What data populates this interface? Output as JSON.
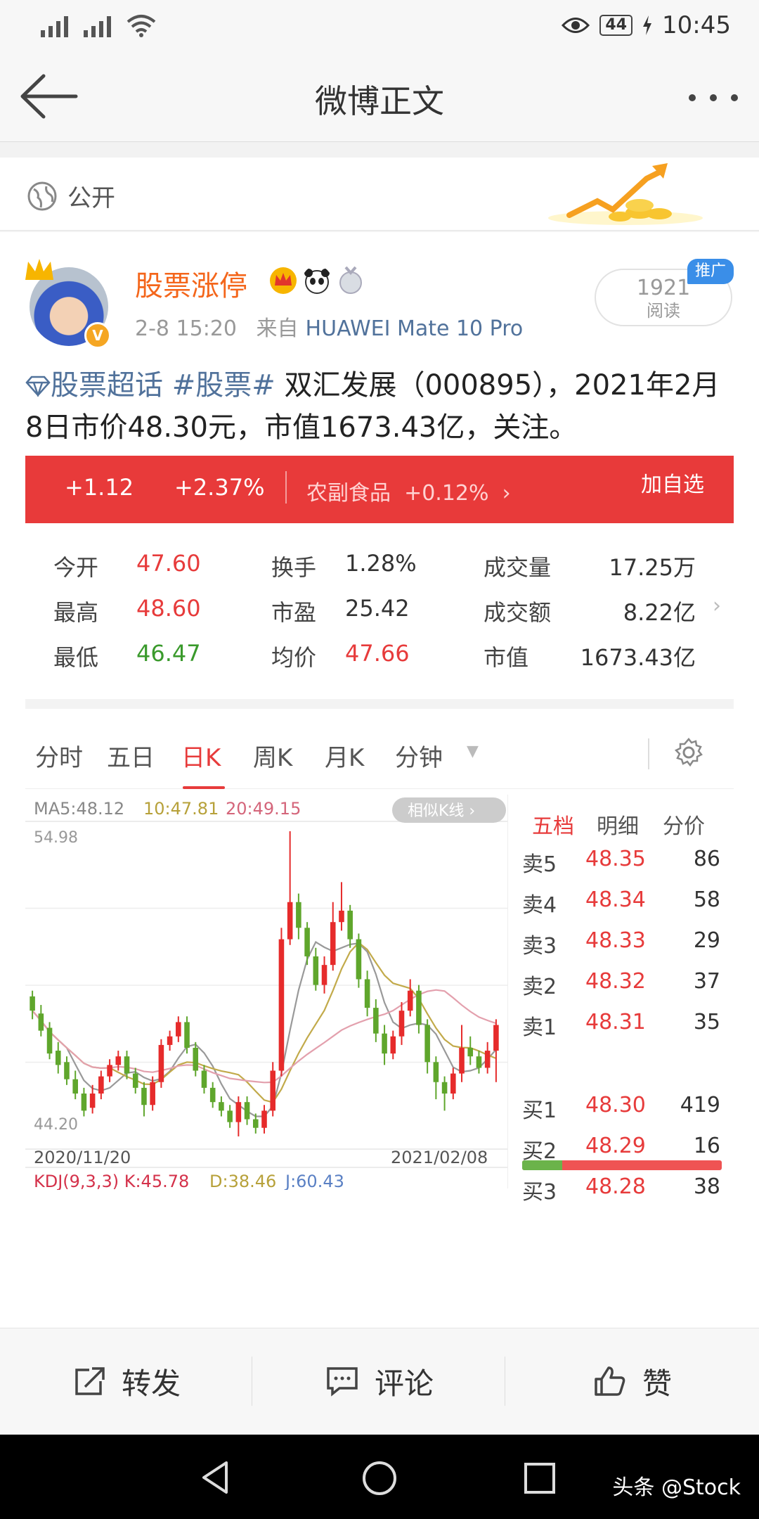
{
  "status_bar": {
    "time": "10:45",
    "battery": "44",
    "icons": [
      "signal-icon",
      "signal-icon",
      "wifi-icon",
      "eye-icon",
      "battery-icon",
      "charging-icon"
    ]
  },
  "nav": {
    "title": "微博正文",
    "back_icon": "back-arrow-icon",
    "more_icon": "more-dots-icon"
  },
  "visibility": {
    "icon": "globe-icon",
    "label": "公开"
  },
  "post": {
    "author": "股票涨停",
    "badges": [
      "crown-badge-icon",
      "panda-badge-icon",
      "medal-badge-icon"
    ],
    "time": "2-8 15:20",
    "source_prefix": "来自",
    "source": "HUAWEI Mate 10 Pro",
    "reads": "1921",
    "reads_label": "阅读",
    "ad_tag": "推广",
    "text": {
      "supertopic": "股票超话",
      "hashtag": "#股票#",
      "body": " 双汇发展（000895），2021年2月8日市价48.30元，市值1673.43亿，关注。"
    }
  },
  "quote_bar": {
    "change": "+1.12",
    "change_pct": "+2.37%",
    "sector": "农副食品",
    "sector_change": "+0.12%",
    "add_watchlist": "加自选"
  },
  "stats": [
    {
      "label": "今开",
      "value": "47.60",
      "color": "red"
    },
    {
      "label": "换手",
      "value": "1.28%",
      "color": "dark"
    },
    {
      "label": "成交量",
      "value": "17.25万",
      "color": "dark"
    },
    {
      "label": "最高",
      "value": "48.60",
      "color": "red"
    },
    {
      "label": "市盈",
      "value": "25.42",
      "color": "dark"
    },
    {
      "label": "成交额",
      "value": "8.22亿",
      "color": "dark"
    },
    {
      "label": "最低",
      "value": "46.47",
      "color": "green"
    },
    {
      "label": "均价",
      "value": "47.66",
      "color": "red"
    },
    {
      "label": "市值",
      "value": "1673.43亿",
      "color": "dark"
    }
  ],
  "chart_tabs": {
    "items": [
      "分时",
      "五日",
      "日K",
      "周K",
      "月K",
      "分钟"
    ],
    "active": "日K",
    "settings_icon": "gear-icon"
  },
  "kline": {
    "ma_labels": [
      "MA5:48.12",
      "10:47.81",
      "20:49.15"
    ],
    "similar_btn": "相似K线",
    "y_max_label": "54.98",
    "y_min_label": "44.20",
    "date_start": "2020/11/20",
    "date_end": "2021/02/08",
    "kdj_labels": [
      "KDJ(9,3,3) K:45.78",
      "D:38.46",
      "J:60.43"
    ]
  },
  "chart_data": {
    "type": "candlestick",
    "title": "",
    "ylim": [
      44.2,
      54.98
    ],
    "x_range": [
      "2020/11/20",
      "2021/02/08"
    ],
    "ma": {
      "MA5": 48.12,
      "MA10": 47.81,
      "MA20": 49.15
    },
    "candles": [
      [
        49.2,
        48.7,
        49.4,
        48.4
      ],
      [
        48.6,
        48.0,
        48.9,
        47.8
      ],
      [
        48.1,
        47.2,
        48.3,
        47.0
      ],
      [
        47.3,
        46.8,
        47.6,
        46.5
      ],
      [
        46.9,
        46.3,
        47.1,
        46.1
      ],
      [
        46.3,
        45.8,
        46.6,
        45.6
      ],
      [
        45.8,
        45.2,
        46.0,
        45.0
      ],
      [
        45.3,
        45.8,
        46.1,
        45.1
      ],
      [
        45.8,
        46.4,
        46.6,
        45.6
      ],
      [
        46.4,
        46.8,
        47.0,
        46.2
      ],
      [
        46.8,
        47.1,
        47.3,
        46.6
      ],
      [
        47.1,
        46.5,
        47.3,
        46.3
      ],
      [
        46.5,
        46.0,
        46.7,
        45.8
      ],
      [
        46.0,
        45.4,
        46.2,
        45.0
      ],
      [
        45.4,
        46.2,
        46.4,
        45.2
      ],
      [
        46.2,
        47.5,
        47.7,
        46.0
      ],
      [
        47.5,
        47.8,
        48.0,
        47.3
      ],
      [
        47.8,
        48.3,
        48.5,
        47.6
      ],
      [
        48.3,
        47.4,
        48.5,
        47.2
      ],
      [
        47.4,
        46.6,
        47.6,
        46.4
      ],
      [
        46.6,
        46.0,
        46.8,
        45.8
      ],
      [
        46.0,
        45.5,
        46.2,
        45.3
      ],
      [
        45.5,
        45.2,
        45.7,
        45.0
      ],
      [
        45.2,
        44.8,
        45.4,
        44.6
      ],
      [
        44.8,
        45.5,
        45.7,
        44.3
      ],
      [
        45.5,
        44.9,
        45.7,
        44.7
      ],
      [
        44.9,
        44.6,
        45.1,
        44.4
      ],
      [
        44.6,
        45.2,
        45.4,
        44.4
      ],
      [
        45.2,
        46.6,
        46.9,
        45.0
      ],
      [
        46.6,
        51.2,
        51.6,
        46.4
      ],
      [
        51.2,
        52.5,
        54.98,
        51.0
      ],
      [
        52.5,
        51.6,
        52.8,
        51.2
      ],
      [
        51.6,
        50.6,
        51.8,
        50.3
      ],
      [
        50.6,
        49.6,
        50.9,
        49.4
      ],
      [
        49.6,
        50.3,
        50.6,
        49.3
      ],
      [
        50.3,
        51.8,
        52.5,
        50.1
      ],
      [
        51.8,
        52.2,
        53.2,
        51.5
      ],
      [
        52.2,
        51.2,
        52.4,
        50.9
      ],
      [
        51.2,
        49.8,
        51.4,
        49.5
      ],
      [
        49.8,
        48.8,
        50.1,
        48.5
      ],
      [
        48.8,
        47.9,
        49.1,
        47.6
      ],
      [
        47.9,
        47.2,
        48.2,
        46.8
      ],
      [
        47.2,
        47.8,
        48.0,
        47.0
      ],
      [
        47.8,
        48.7,
        49.0,
        47.5
      ],
      [
        48.7,
        49.4,
        49.8,
        48.5
      ],
      [
        49.4,
        48.2,
        49.6,
        47.9
      ],
      [
        48.2,
        46.9,
        48.4,
        46.5
      ],
      [
        46.9,
        46.2,
        47.1,
        45.6
      ],
      [
        46.2,
        45.8,
        46.4,
        45.2
      ],
      [
        45.8,
        46.5,
        46.7,
        45.6
      ],
      [
        46.5,
        47.4,
        48.2,
        46.2
      ],
      [
        47.4,
        47.1,
        47.8,
        46.8
      ],
      [
        47.1,
        46.7,
        47.3,
        46.5
      ],
      [
        46.7,
        47.3,
        47.6,
        46.5
      ],
      [
        47.3,
        48.2,
        48.4,
        46.2
      ]
    ]
  },
  "order_book": {
    "tabs": [
      "五档",
      "明细",
      "分价"
    ],
    "active_tab": "五档",
    "asks": [
      {
        "name": "卖5",
        "price": "48.35",
        "vol": "86"
      },
      {
        "name": "卖4",
        "price": "48.34",
        "vol": "58"
      },
      {
        "name": "卖3",
        "price": "48.33",
        "vol": "29"
      },
      {
        "name": "卖2",
        "price": "48.32",
        "vol": "37"
      },
      {
        "name": "卖1",
        "price": "48.31",
        "vol": "35"
      }
    ],
    "buy_ratio": 0.2,
    "bids": [
      {
        "name": "买1",
        "price": "48.30",
        "vol": "419"
      },
      {
        "name": "买2",
        "price": "48.29",
        "vol": "16"
      },
      {
        "name": "买3",
        "price": "48.28",
        "vol": "38"
      }
    ]
  },
  "actions": [
    {
      "label": "转发",
      "icon": "share-icon"
    },
    {
      "label": "评论",
      "icon": "comment-icon"
    },
    {
      "label": "赞",
      "icon": "like-icon"
    }
  ],
  "watermark": "头条 @Stock",
  "colors": {
    "up": "#e73b3b",
    "down": "#3a9a2c",
    "quote_bar": "#e83a3a",
    "link": "#51729b",
    "author": "#f4661b"
  }
}
